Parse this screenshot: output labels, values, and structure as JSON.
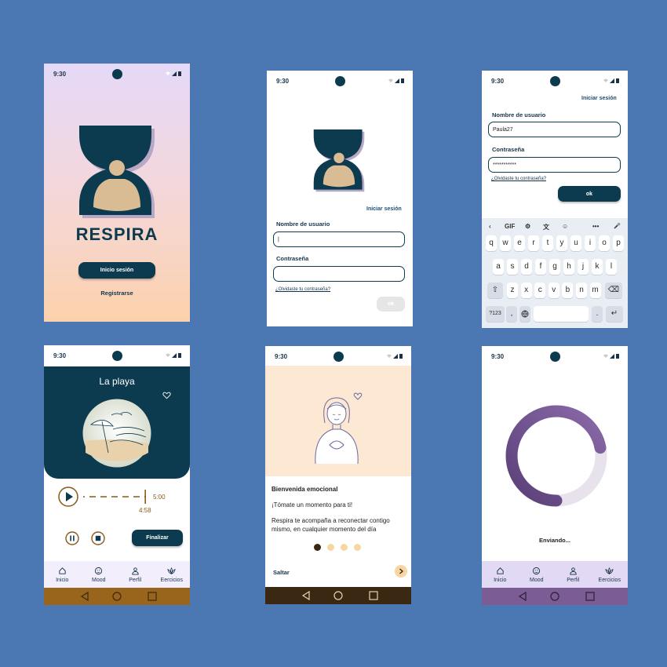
{
  "colors": {
    "background": "#4b77b2",
    "primary": "#0c3a4e",
    "sand": "#d9bc93",
    "peach": "#fde9d3",
    "lavender": "#e6dcf7",
    "player_accent": "#8a5a1a",
    "nav_brown": "#99641c",
    "nav_dark": "#3a2812",
    "nav_purple": "#7b5c95",
    "progress_purple": "#7a5f95"
  },
  "status_time": "9:30",
  "splash": {
    "app_name": "RESPIRA",
    "login_button": "Inicio sesión",
    "register_link": "Registrarse"
  },
  "login": {
    "top_link": "Iniciar sesión",
    "username_label": "Nombre de usuario",
    "username_value": "|",
    "password_label": "Contraseña",
    "password_value": "",
    "forgot_link": "¿Olvidaste tu contraseña?",
    "ok_button": "ok"
  },
  "login_typing": {
    "top_link": "Iniciar sesión",
    "username_label": "Nombre de usuario",
    "username_value": "Paula27",
    "password_label": "Contraseña",
    "password_value": "***********",
    "forgot_link": "¿Olvidaste tu contraseña?",
    "ok_button": "ok",
    "keyboard": {
      "toolbar": [
        "‹",
        "GIF",
        "⚙",
        "文",
        "☺",
        "•••",
        "🎤"
      ],
      "row1": [
        "q",
        "w",
        "e",
        "r",
        "t",
        "y",
        "u",
        "i",
        "o",
        "p"
      ],
      "row2": [
        "a",
        "s",
        "d",
        "f",
        "g",
        "h",
        "j",
        "k",
        "l"
      ],
      "row3": [
        "z",
        "x",
        "c",
        "v",
        "b",
        "n",
        "m"
      ],
      "shift": "⇧",
      "backspace": "⌫",
      "symbols": "?123",
      "emoji_comma": ",",
      "period": ".",
      "enter": "↵"
    }
  },
  "player": {
    "title": "La playa",
    "total_time": "5:00",
    "elapsed_time": "4:58",
    "progress": 0.99,
    "finish_button": "Finalizar"
  },
  "tabs": [
    {
      "label": "Inicio",
      "icon": "home-icon"
    },
    {
      "label": "Mood",
      "icon": "mood-icon"
    },
    {
      "label": "Perfil",
      "icon": "profile-icon"
    },
    {
      "label": "Eercicios",
      "icon": "lotus-icon"
    }
  ],
  "onboarding": {
    "title": "Bienvenida emocional",
    "line1": "¡Tómate un momento para ti!",
    "line2": "Respira te acompaña a reconectar contigo mismo, en cualquier momento del día",
    "skip": "Saltar",
    "page_count": 4,
    "current_page": 1
  },
  "sending": {
    "label": "Enviando...",
    "progress": 0.72
  }
}
